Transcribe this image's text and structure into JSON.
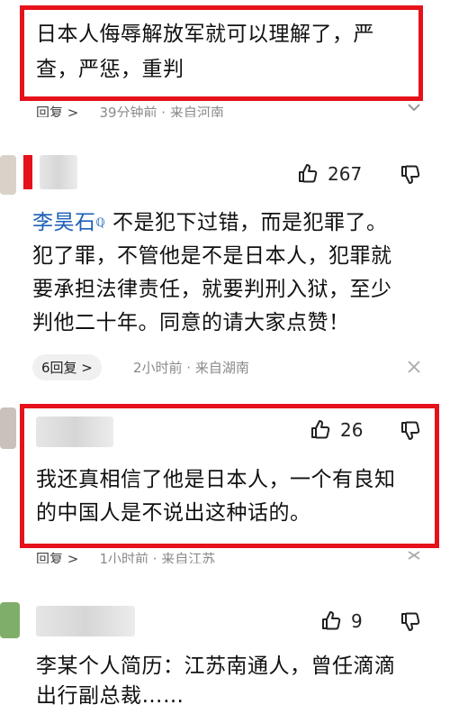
{
  "comment1": {
    "text_line1": "日本人侮辱解放军就可以理解了，严",
    "text_line2": "查，严惩，重判",
    "reply_btn": "回复 >",
    "meta": "39分钟前 · 来自河南"
  },
  "comment2": {
    "likes": "267",
    "author": "李昊石",
    "text_inline": "不是犯下过错，而是犯罪了。",
    "text_line2": "犯了罪，不管他是不是日本人，犯罪就",
    "text_line3": "要承担法律责任，就要判刑入狱，至少",
    "text_line4": "判他二十年。同意的请大家点赞！",
    "replies": "6回复 >",
    "meta": "2小时前 · 来自湖南"
  },
  "comment3": {
    "likes": "26",
    "text_line1": "我还真相信了他是日本人，一个有良知",
    "text_line2": "的中国人是不说出这种话的。",
    "reply_btn": "回复 >",
    "meta": "1小时前 · 来自江苏"
  },
  "comment4": {
    "likes": "9",
    "text_line1": "李某个人简历：江苏南通人，曾任滴滴",
    "text_line2": "出行副总裁……"
  },
  "colors": {
    "highlight": "#e5121b",
    "link": "#1d5fb8"
  }
}
